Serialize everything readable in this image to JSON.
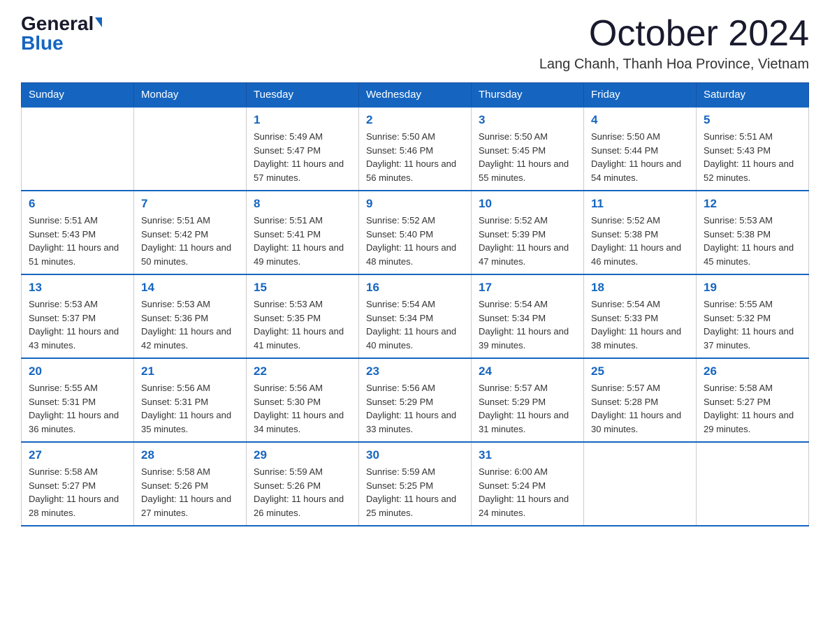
{
  "logo": {
    "general": "General",
    "blue": "Blue"
  },
  "title": {
    "month": "October 2024",
    "location": "Lang Chanh, Thanh Hoa Province, Vietnam"
  },
  "weekdays": [
    "Sunday",
    "Monday",
    "Tuesday",
    "Wednesday",
    "Thursday",
    "Friday",
    "Saturday"
  ],
  "weeks": [
    [
      {
        "day": "",
        "sunrise": "",
        "sunset": "",
        "daylight": ""
      },
      {
        "day": "",
        "sunrise": "",
        "sunset": "",
        "daylight": ""
      },
      {
        "day": "1",
        "sunrise": "Sunrise: 5:49 AM",
        "sunset": "Sunset: 5:47 PM",
        "daylight": "Daylight: 11 hours and 57 minutes."
      },
      {
        "day": "2",
        "sunrise": "Sunrise: 5:50 AM",
        "sunset": "Sunset: 5:46 PM",
        "daylight": "Daylight: 11 hours and 56 minutes."
      },
      {
        "day": "3",
        "sunrise": "Sunrise: 5:50 AM",
        "sunset": "Sunset: 5:45 PM",
        "daylight": "Daylight: 11 hours and 55 minutes."
      },
      {
        "day": "4",
        "sunrise": "Sunrise: 5:50 AM",
        "sunset": "Sunset: 5:44 PM",
        "daylight": "Daylight: 11 hours and 54 minutes."
      },
      {
        "day": "5",
        "sunrise": "Sunrise: 5:51 AM",
        "sunset": "Sunset: 5:43 PM",
        "daylight": "Daylight: 11 hours and 52 minutes."
      }
    ],
    [
      {
        "day": "6",
        "sunrise": "Sunrise: 5:51 AM",
        "sunset": "Sunset: 5:43 PM",
        "daylight": "Daylight: 11 hours and 51 minutes."
      },
      {
        "day": "7",
        "sunrise": "Sunrise: 5:51 AM",
        "sunset": "Sunset: 5:42 PM",
        "daylight": "Daylight: 11 hours and 50 minutes."
      },
      {
        "day": "8",
        "sunrise": "Sunrise: 5:51 AM",
        "sunset": "Sunset: 5:41 PM",
        "daylight": "Daylight: 11 hours and 49 minutes."
      },
      {
        "day": "9",
        "sunrise": "Sunrise: 5:52 AM",
        "sunset": "Sunset: 5:40 PM",
        "daylight": "Daylight: 11 hours and 48 minutes."
      },
      {
        "day": "10",
        "sunrise": "Sunrise: 5:52 AM",
        "sunset": "Sunset: 5:39 PM",
        "daylight": "Daylight: 11 hours and 47 minutes."
      },
      {
        "day": "11",
        "sunrise": "Sunrise: 5:52 AM",
        "sunset": "Sunset: 5:38 PM",
        "daylight": "Daylight: 11 hours and 46 minutes."
      },
      {
        "day": "12",
        "sunrise": "Sunrise: 5:53 AM",
        "sunset": "Sunset: 5:38 PM",
        "daylight": "Daylight: 11 hours and 45 minutes."
      }
    ],
    [
      {
        "day": "13",
        "sunrise": "Sunrise: 5:53 AM",
        "sunset": "Sunset: 5:37 PM",
        "daylight": "Daylight: 11 hours and 43 minutes."
      },
      {
        "day": "14",
        "sunrise": "Sunrise: 5:53 AM",
        "sunset": "Sunset: 5:36 PM",
        "daylight": "Daylight: 11 hours and 42 minutes."
      },
      {
        "day": "15",
        "sunrise": "Sunrise: 5:53 AM",
        "sunset": "Sunset: 5:35 PM",
        "daylight": "Daylight: 11 hours and 41 minutes."
      },
      {
        "day": "16",
        "sunrise": "Sunrise: 5:54 AM",
        "sunset": "Sunset: 5:34 PM",
        "daylight": "Daylight: 11 hours and 40 minutes."
      },
      {
        "day": "17",
        "sunrise": "Sunrise: 5:54 AM",
        "sunset": "Sunset: 5:34 PM",
        "daylight": "Daylight: 11 hours and 39 minutes."
      },
      {
        "day": "18",
        "sunrise": "Sunrise: 5:54 AM",
        "sunset": "Sunset: 5:33 PM",
        "daylight": "Daylight: 11 hours and 38 minutes."
      },
      {
        "day": "19",
        "sunrise": "Sunrise: 5:55 AM",
        "sunset": "Sunset: 5:32 PM",
        "daylight": "Daylight: 11 hours and 37 minutes."
      }
    ],
    [
      {
        "day": "20",
        "sunrise": "Sunrise: 5:55 AM",
        "sunset": "Sunset: 5:31 PM",
        "daylight": "Daylight: 11 hours and 36 minutes."
      },
      {
        "day": "21",
        "sunrise": "Sunrise: 5:56 AM",
        "sunset": "Sunset: 5:31 PM",
        "daylight": "Daylight: 11 hours and 35 minutes."
      },
      {
        "day": "22",
        "sunrise": "Sunrise: 5:56 AM",
        "sunset": "Sunset: 5:30 PM",
        "daylight": "Daylight: 11 hours and 34 minutes."
      },
      {
        "day": "23",
        "sunrise": "Sunrise: 5:56 AM",
        "sunset": "Sunset: 5:29 PM",
        "daylight": "Daylight: 11 hours and 33 minutes."
      },
      {
        "day": "24",
        "sunrise": "Sunrise: 5:57 AM",
        "sunset": "Sunset: 5:29 PM",
        "daylight": "Daylight: 11 hours and 31 minutes."
      },
      {
        "day": "25",
        "sunrise": "Sunrise: 5:57 AM",
        "sunset": "Sunset: 5:28 PM",
        "daylight": "Daylight: 11 hours and 30 minutes."
      },
      {
        "day": "26",
        "sunrise": "Sunrise: 5:58 AM",
        "sunset": "Sunset: 5:27 PM",
        "daylight": "Daylight: 11 hours and 29 minutes."
      }
    ],
    [
      {
        "day": "27",
        "sunrise": "Sunrise: 5:58 AM",
        "sunset": "Sunset: 5:27 PM",
        "daylight": "Daylight: 11 hours and 28 minutes."
      },
      {
        "day": "28",
        "sunrise": "Sunrise: 5:58 AM",
        "sunset": "Sunset: 5:26 PM",
        "daylight": "Daylight: 11 hours and 27 minutes."
      },
      {
        "day": "29",
        "sunrise": "Sunrise: 5:59 AM",
        "sunset": "Sunset: 5:26 PM",
        "daylight": "Daylight: 11 hours and 26 minutes."
      },
      {
        "day": "30",
        "sunrise": "Sunrise: 5:59 AM",
        "sunset": "Sunset: 5:25 PM",
        "daylight": "Daylight: 11 hours and 25 minutes."
      },
      {
        "day": "31",
        "sunrise": "Sunrise: 6:00 AM",
        "sunset": "Sunset: 5:24 PM",
        "daylight": "Daylight: 11 hours and 24 minutes."
      },
      {
        "day": "",
        "sunrise": "",
        "sunset": "",
        "daylight": ""
      },
      {
        "day": "",
        "sunrise": "",
        "sunset": "",
        "daylight": ""
      }
    ]
  ]
}
